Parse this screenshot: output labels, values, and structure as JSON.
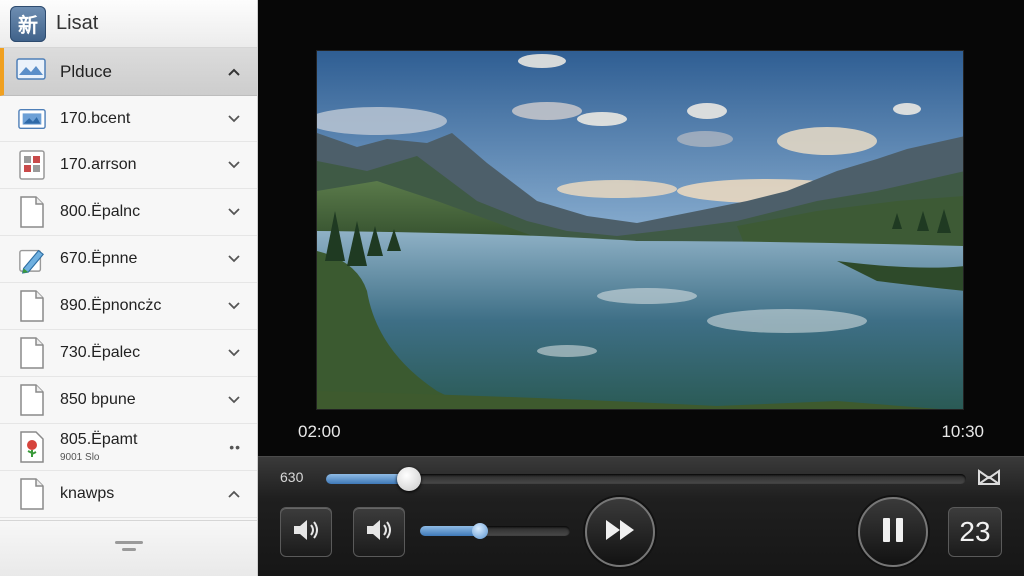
{
  "app": {
    "icon_glyph": "新",
    "title": "Lisat"
  },
  "sidebar": {
    "section": {
      "label": "Plduce"
    },
    "items": [
      {
        "name": "170.bcent",
        "icon": "image-file-icon",
        "trail": "chevron"
      },
      {
        "name": "170.arrson",
        "icon": "puzzle-file-icon",
        "trail": "chevron"
      },
      {
        "name": "800.Ëpalnc",
        "icon": "document-icon",
        "trail": "chevron"
      },
      {
        "name": "670.Ëpnne",
        "icon": "pencil-file-icon",
        "trail": "chevron"
      },
      {
        "name": "890.Ëpnoncżc",
        "icon": "document-icon",
        "trail": "chevron"
      },
      {
        "name": "730.Ëpalec",
        "icon": "document-icon",
        "trail": "chevron"
      },
      {
        "name": "850 bpune",
        "icon": "document-icon",
        "trail": "chevron"
      },
      {
        "name": "805.Ëpamt",
        "sub": "9001 Slo",
        "icon": "flower-file-icon",
        "trail": "dots"
      },
      {
        "name": "knawps",
        "icon": "document-icon",
        "trail": "chevron-up"
      }
    ]
  },
  "player": {
    "time_current": "02:00",
    "time_total": "10:30",
    "seek_label": "630",
    "seek_progress": 0.13,
    "volume_level": 0.4,
    "counter_label": "23"
  },
  "colors": {
    "accent": "#f0a020",
    "fill": "#4f8ac9"
  }
}
